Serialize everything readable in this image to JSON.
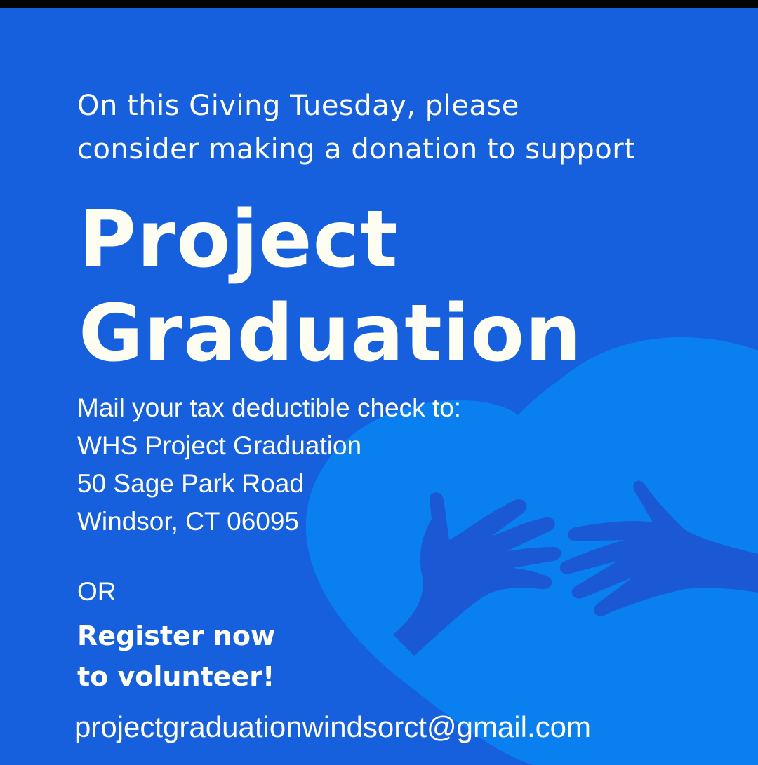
{
  "intro": {
    "line1": "On this Giving Tuesday, please",
    "line2": "consider making a donation to support"
  },
  "title": {
    "line1": "Project",
    "line2": "Graduation"
  },
  "mail": {
    "line1": "Mail your tax deductible check to:",
    "line2": "WHS Project Graduation",
    "line3": "50 Sage Park Road",
    "line4": "Windsor, CT 06095"
  },
  "or_label": "OR",
  "register": {
    "line1": "Register now",
    "line2": "to volunteer!"
  },
  "email": "projectgraduationwindsorct@gmail.com",
  "colors": {
    "background": "#1660de",
    "heart": "#0a7ff0",
    "hands": "#1a5ad6",
    "text": "#fdfdf2"
  },
  "icons": [
    "heart-icon",
    "hands-icon"
  ]
}
